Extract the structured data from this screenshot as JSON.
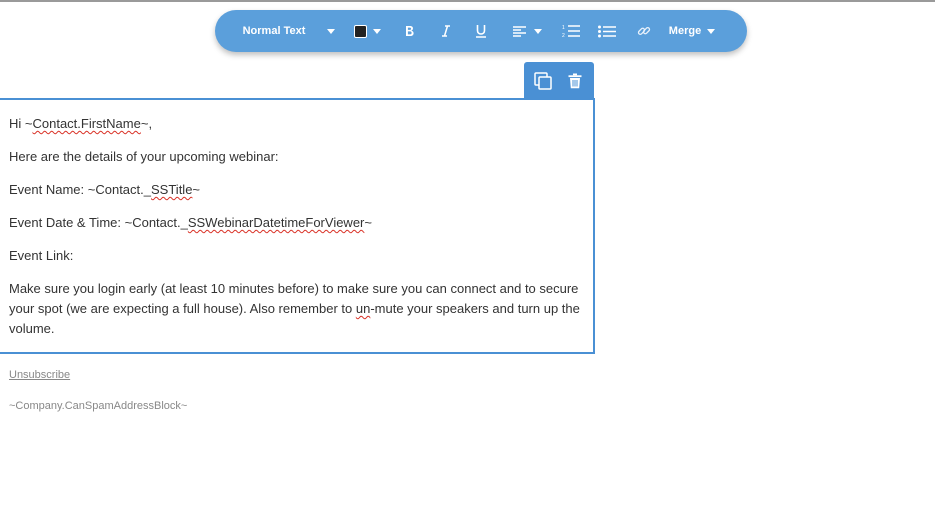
{
  "toolbar": {
    "text_style": "Normal Text",
    "merge_label": "Merge",
    "text_color": "#222222",
    "accent": "#5b9fdb"
  },
  "block_actions": {
    "accent": "#4a90d4",
    "icons": [
      "copy-icon",
      "trash-icon"
    ]
  },
  "editor": {
    "greeting_prefix": "Hi ~",
    "greeting_token": "Contact.FirstName",
    "greeting_suffix": "~,",
    "intro": "Here are the details of your upcoming webinar:",
    "event_name_prefix": "Event Name: ~Contact._",
    "event_name_token": "SSTitle",
    "event_name_suffix": "~",
    "event_date_prefix": "Event Date & Time: ~Contact._",
    "event_date_token": "SSWebinarDatetimeForViewer",
    "event_date_suffix": "~",
    "event_link": "Event Link:",
    "note_part1": "Make sure you login early (at least 10 minutes before) to make sure you can connect and to secure your spot (we are expecting a full house). Also remember to ",
    "note_token": "un",
    "note_part2": "-mute your speakers and turn up the volume."
  },
  "footer": {
    "unsubscribe": "Unsubscribe",
    "address": "~Company.CanSpamAddressBlock~"
  }
}
